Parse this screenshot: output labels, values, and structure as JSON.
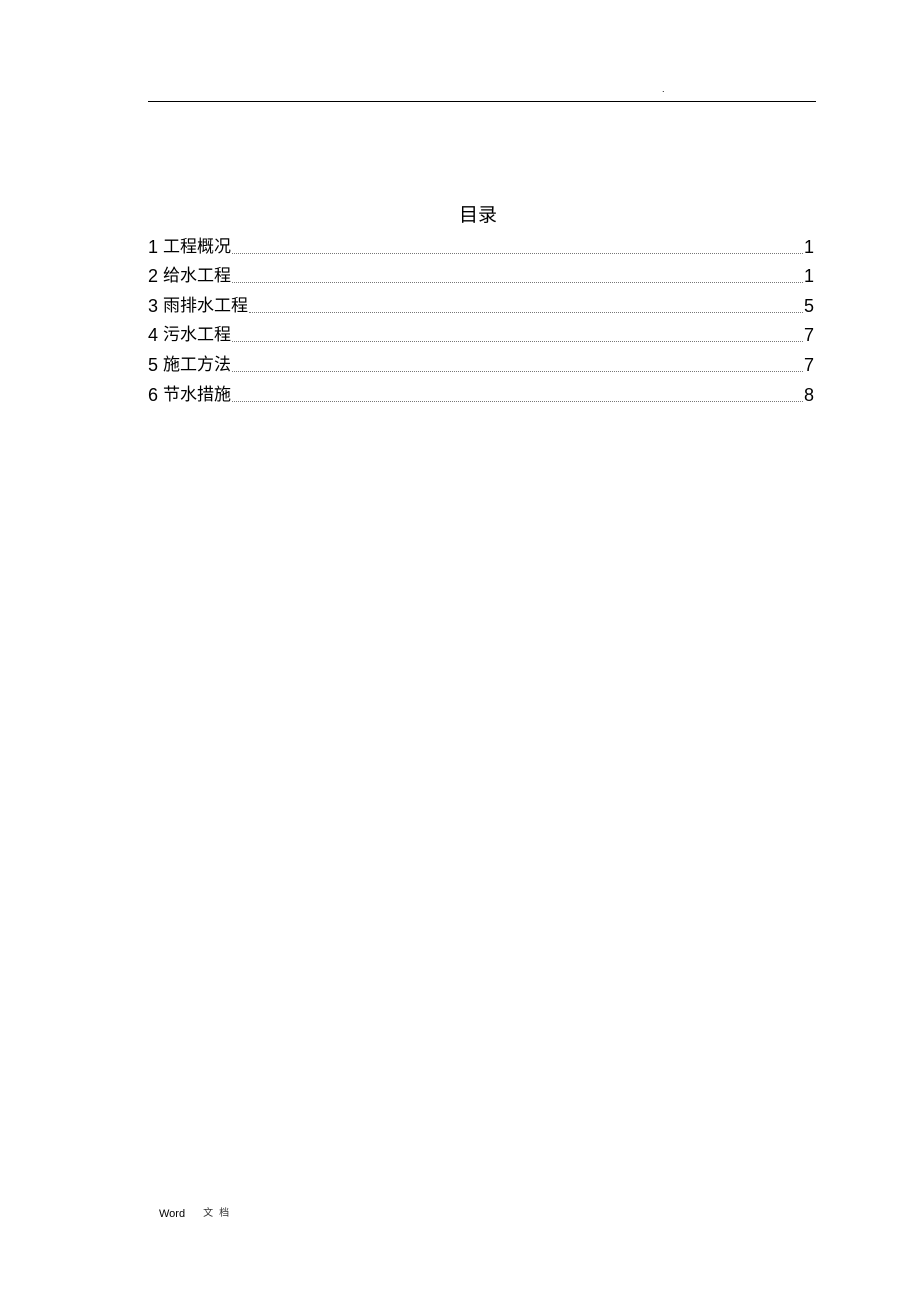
{
  "header": {
    "mark": "."
  },
  "toc": {
    "title": "目录",
    "entries": [
      {
        "number": "1",
        "label": "工程概况",
        "page": "1"
      },
      {
        "number": "2",
        "label": "给水工程",
        "page": "1"
      },
      {
        "number": "3",
        "label": "雨排水工程",
        "page": "5"
      },
      {
        "number": "4",
        "label": "污水工程",
        "page": "7"
      },
      {
        "number": "5",
        "label": "施工方法",
        "page": "7"
      },
      {
        "number": "6",
        "label": "节水措施",
        "page": "8"
      }
    ]
  },
  "footer": {
    "app": "Word",
    "doc": "文档"
  }
}
